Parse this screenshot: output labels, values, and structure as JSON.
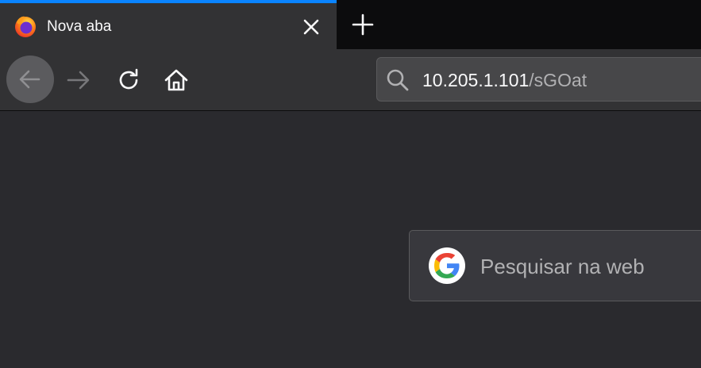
{
  "tab": {
    "title": "Nova aba",
    "favicon": "firefox-icon",
    "close_icon": "close-icon",
    "active_indicator_color": "#0a84ff"
  },
  "tabstrip": {
    "new_tab_icon": "plus-icon"
  },
  "navbar": {
    "back_icon": "arrow-left-icon",
    "forward_icon": "arrow-right-icon",
    "reload_icon": "reload-icon",
    "home_icon": "home-icon"
  },
  "urlbar": {
    "search_icon": "search-icon",
    "host": "10.205.1.101",
    "path": "/sGOat"
  },
  "newtab_search": {
    "engine_icon": "google-icon",
    "placeholder": "Pesquisar na web"
  }
}
